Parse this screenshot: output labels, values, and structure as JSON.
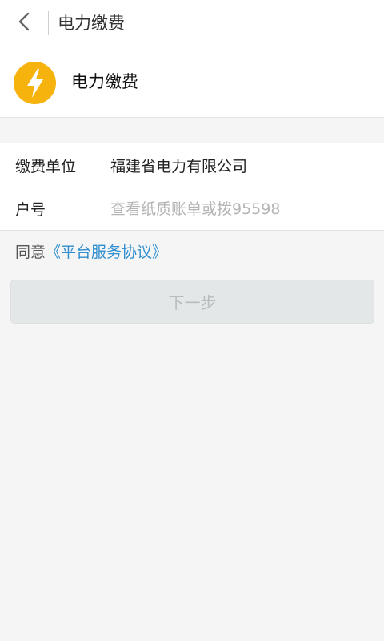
{
  "titlebar": {
    "back_icon": "chevron-left-icon",
    "title": "电力缴费"
  },
  "service": {
    "icon": "lightning-bolt-icon",
    "icon_color": "#f6b20d",
    "name": "电力缴费"
  },
  "form": {
    "unit": {
      "label": "缴费单位",
      "value": "福建省电力有限公司"
    },
    "account": {
      "label": "户号",
      "value": "",
      "placeholder": "查看纸质账单或拨95598"
    }
  },
  "agreement": {
    "prefix": "同意",
    "link": "《平台服务协议》",
    "link_color": "#2f8fd0"
  },
  "next_button": {
    "label": "下一步",
    "state": "disabled"
  }
}
